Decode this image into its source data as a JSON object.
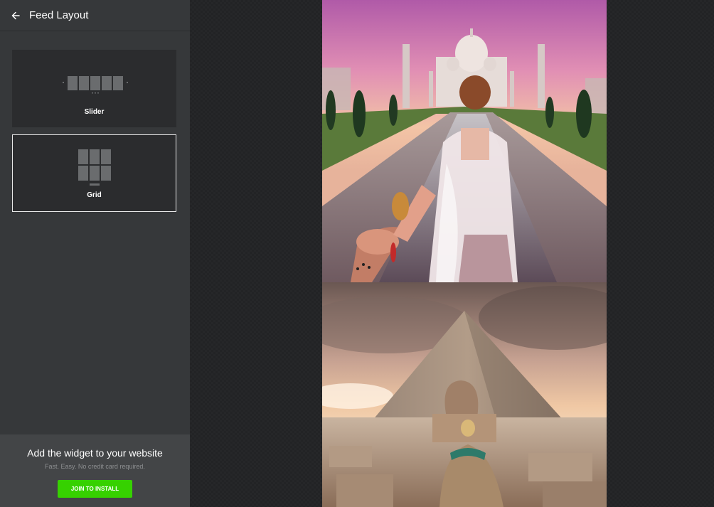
{
  "header": {
    "title": "Feed Layout"
  },
  "layouts": [
    {
      "label": "Slider",
      "selected": false
    },
    {
      "label": "Grid",
      "selected": true
    }
  ],
  "promo": {
    "title": "Add the widget to your website",
    "subtitle": "Fast. Easy. No credit card required.",
    "button_label": "JOIN TO INSTALL"
  },
  "feed": {
    "items": [
      {
        "image": "taj-mahal-follow-me-photo"
      },
      {
        "image": "pyramid-sphinx-photo"
      }
    ]
  },
  "colors": {
    "accent": "#36d100",
    "sidebar": "#36383a",
    "card": "#2b2c2e"
  }
}
